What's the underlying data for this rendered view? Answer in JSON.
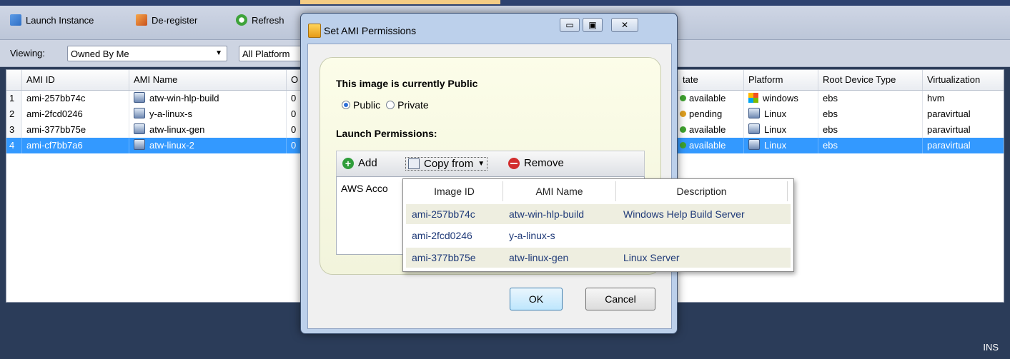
{
  "toolbar": {
    "launch_label": "Launch Instance",
    "deregister_label": "De-register",
    "refresh_label": "Refresh"
  },
  "viewbar": {
    "viewing_label": "Viewing:",
    "owner_value": "Owned By Me",
    "platform_value": "All Platform"
  },
  "grid": {
    "columns": [
      "AMI ID",
      "AMI Name",
      "O",
      "tate",
      "Platform",
      "Root Device Type",
      "Virtualization"
    ],
    "rows": [
      {
        "num": "1",
        "ami_id": "ami-257bb74c",
        "ami_name": "atw-win-hlp-build",
        "owner": "0",
        "state": "available",
        "platform": "windows",
        "root": "ebs",
        "virt": "hvm"
      },
      {
        "num": "2",
        "ami_id": "ami-2fcd0246",
        "ami_name": "y-a-linux-s",
        "owner": "0",
        "state": "pending",
        "platform": "Linux",
        "root": "ebs",
        "virt": "paravirtual"
      },
      {
        "num": "3",
        "ami_id": "ami-377bb75e",
        "ami_name": "atw-linux-gen",
        "owner": "0",
        "state": "available",
        "platform": "Linux",
        "root": "ebs",
        "virt": "paravirtual"
      },
      {
        "num": "4",
        "ami_id": "ami-cf7bb7a6",
        "ami_name": "atw-linux-2",
        "owner": "0",
        "state": "available",
        "platform": "Linux",
        "root": "ebs",
        "virt": "paravirtual"
      }
    ]
  },
  "dialog": {
    "title": "Set AMI Permissions",
    "status_text": "This image is currently Public",
    "public_label": "Public",
    "private_label": "Private",
    "launch_permissions_label": "Launch Permissions:",
    "add_label": "Add",
    "copy_from_label": "Copy from",
    "remove_label": "Remove",
    "account_header": "AWS Acco",
    "ok_label": "OK",
    "cancel_label": "Cancel"
  },
  "popup": {
    "headers": [
      "Image ID",
      "AMI Name",
      "Description"
    ],
    "rows": [
      {
        "image_id": "ami-257bb74c",
        "ami_name": "atw-win-hlp-build",
        "description": "Windows Help Build Server"
      },
      {
        "image_id": "ami-2fcd0246",
        "ami_name": "y-a-linux-s",
        "description": ""
      },
      {
        "image_id": "ami-377bb75e",
        "ami_name": "atw-linux-gen",
        "description": "Linux Server"
      }
    ]
  },
  "statusbar": {
    "mode": "INS"
  },
  "colors": {
    "selection": "#3399ff",
    "accent": "#2b3c59"
  }
}
